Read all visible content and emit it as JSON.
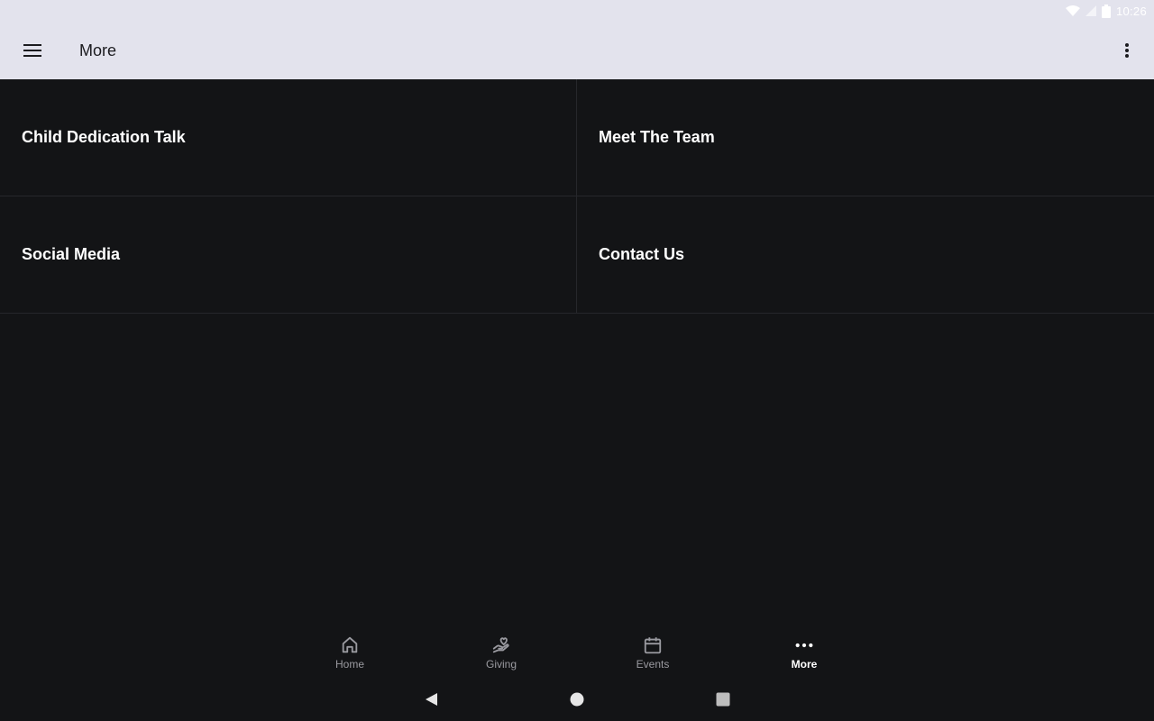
{
  "status_bar": {
    "time": "10:26"
  },
  "app_bar": {
    "title": "More"
  },
  "tiles": [
    {
      "label": "Child Dedication Talk"
    },
    {
      "label": "Meet The Team"
    },
    {
      "label": "Social Media"
    },
    {
      "label": "Contact Us"
    }
  ],
  "bottom_nav": {
    "items": [
      {
        "label": "Home",
        "icon": "home-icon"
      },
      {
        "label": "Giving",
        "icon": "hand-heart-icon"
      },
      {
        "label": "Events",
        "icon": "calendar-icon"
      },
      {
        "label": "More",
        "icon": "more-horizontal-icon"
      }
    ],
    "active": "More"
  },
  "colors": {
    "background": "#131416",
    "app_bar": "#e3e3ed",
    "divider": "#26272b",
    "active_label": "#ffffff",
    "inactive_label": "#9a9aa0"
  }
}
